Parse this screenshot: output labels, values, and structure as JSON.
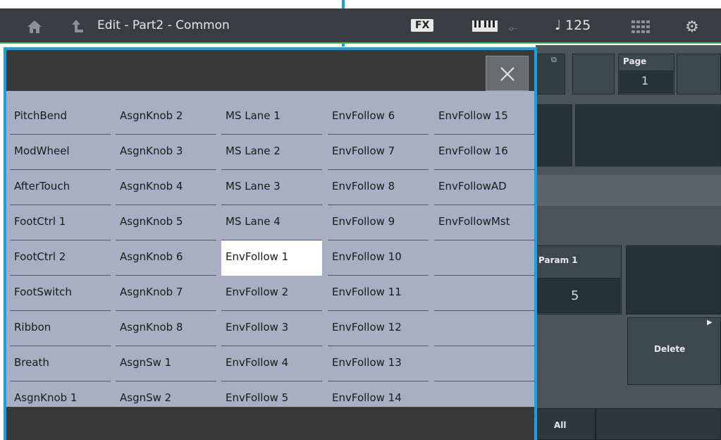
{
  "topbar": {
    "title": "Edit - Part2 - Common",
    "fx_label": "FX",
    "tempo": "♩ 125",
    "icons": [
      "home-icon",
      "up-arrow-icon",
      "keyboard-icon",
      "usb-icon",
      "grid-icon",
      "gear-icon"
    ]
  },
  "background_panel": {
    "page_label": "Page",
    "page_value": "1",
    "param_label": "Param 1",
    "param_value": "5",
    "delete_label": "Delete",
    "tab_all": "All"
  },
  "popup": {
    "close_label": "×",
    "selected": "EnvFollow 1",
    "columns": [
      [
        "PitchBend",
        "ModWheel",
        "AfterTouch",
        "FootCtrl 1",
        "FootCtrl 2",
        "FootSwitch",
        "Ribbon",
        "Breath",
        "AsgnKnob 1"
      ],
      [
        "AsgnKnob 2",
        "AsgnKnob 3",
        "AsgnKnob 4",
        "AsgnKnob 5",
        "AsgnKnob 6",
        "AsgnKnob 7",
        "AsgnKnob 8",
        "AsgnSw 1",
        "AsgnSw 2"
      ],
      [
        "MS Lane 1",
        "MS Lane 2",
        "MS Lane 3",
        "MS Lane 4",
        "EnvFollow 1",
        "EnvFollow 2",
        "EnvFollow 3",
        "EnvFollow 4",
        "EnvFollow 5"
      ],
      [
        "EnvFollow 6",
        "EnvFollow 7",
        "EnvFollow 8",
        "EnvFollow 9",
        "EnvFollow 10",
        "EnvFollow 11",
        "EnvFollow 12",
        "EnvFollow 13",
        "EnvFollow 14"
      ],
      [
        "EnvFollow 15",
        "EnvFollow 16",
        "EnvFollowAD",
        "EnvFollowMst",
        "",
        "",
        "",
        "",
        ""
      ]
    ]
  }
}
